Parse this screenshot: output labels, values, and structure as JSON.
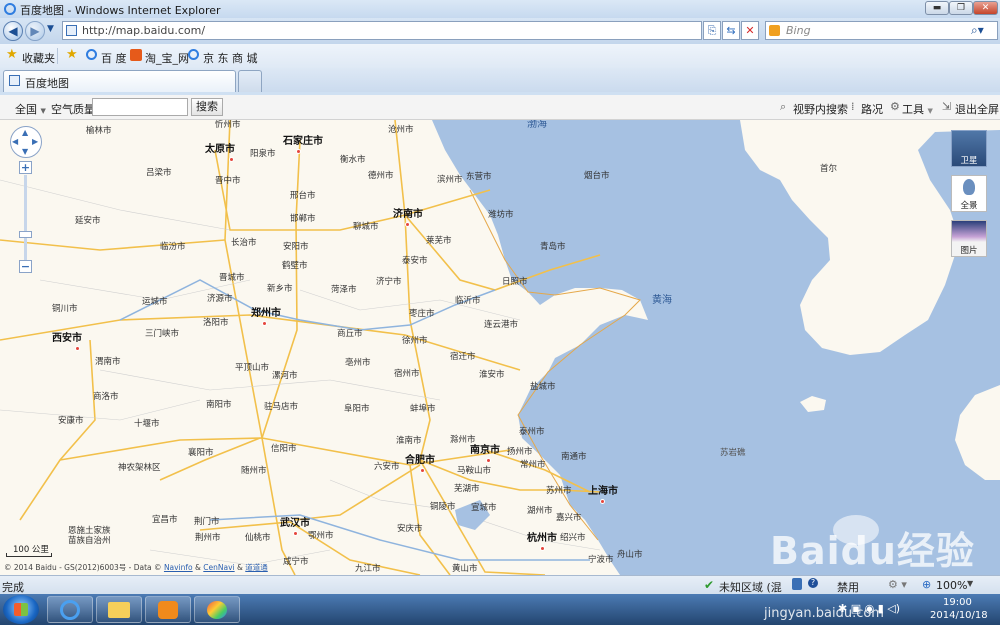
{
  "window": {
    "title": "百度地图 - Windows Internet Explorer"
  },
  "address": {
    "url": "http://map.baidu.com/",
    "search_placeholder": "Bing"
  },
  "favorites": {
    "label": "收藏夹",
    "items": [
      "百 度",
      "淘_宝_网",
      "京 东 商 城"
    ]
  },
  "tab": {
    "title": "百度地图"
  },
  "map_toolbar": {
    "region": "全国",
    "air_quality": "空气质量",
    "search_value": "",
    "search_button": "搜索",
    "right_items": [
      "视野内搜索",
      "路况",
      "工具",
      "退出全屏"
    ]
  },
  "map_side": {
    "satellite": "卫星",
    "panorama": "全景",
    "photo": "图片"
  },
  "map": {
    "scale": "100 公里",
    "copyright": [
      "© 2014 Baidu - GS(2012)6003号 - Data ©",
      "Navinfo",
      "&",
      "CenNavi",
      "&",
      "道道通"
    ],
    "seas": [
      "渤海",
      "黄海"
    ],
    "major_cities": [
      "太原市",
      "石家庄市",
      "济南市",
      "郑州市",
      "西安市",
      "合肥市",
      "南京市",
      "上海市",
      "武汉市",
      "杭州市",
      "首尔"
    ],
    "cities": [
      "榆林市",
      "忻州市",
      "沧州市",
      "吕梁市",
      "阳泉市",
      "衡水市",
      "德州市",
      "滨州市",
      "东营市",
      "烟台市",
      "晋中市",
      "邢台市",
      "潍坊市",
      "延安市",
      "邯郸市",
      "聊城市",
      "莱芜市",
      "临汾市",
      "长治市",
      "安阳市",
      "泰安市",
      "青岛市",
      "鹤壁市",
      "晋城市",
      "新乡市",
      "菏泽市",
      "济宁市",
      "日照市",
      "运城市",
      "济源市",
      "临沂市",
      "三门峡市",
      "洛阳市",
      "枣庄市",
      "连云港市",
      "铜川市",
      "商丘市",
      "徐州市",
      "宿迁市",
      "渭南市",
      "平顶山市",
      "漯河市",
      "亳州市",
      "宿州市",
      "淮安市",
      "商洛市",
      "南阳市",
      "驻马店市",
      "阜阳市",
      "蚌埠市",
      "盐城市",
      "安康市",
      "十堰市",
      "淮南市",
      "滁州市",
      "泰州市",
      "南通市",
      "襄阳市",
      "信阳市",
      "六安市",
      "扬州市",
      "马鞍山市",
      "常州市",
      "神农架林区",
      "随州市",
      "芜湖市",
      "苏州市",
      "铜陵市",
      "宣城市",
      "湖州市",
      "嘉兴市",
      "宜昌市",
      "荆门市",
      "恩施土家族苗族自治州",
      "荆州市",
      "仙桃市",
      "鄂州市",
      "安庆市",
      "宁波市",
      "绍兴市",
      "舟山市",
      "咸宁市",
      "九江市",
      "黄山市",
      "苏岩礁"
    ]
  },
  "status": {
    "done": "完成",
    "zone": "未知区域 (混",
    "zoom": "100%",
    "protected": "禁用"
  },
  "taskbar": {
    "time": "19:00",
    "date": "2014/10/18"
  },
  "watermark": {
    "text": "Baidu经验",
    "url": "jingyan.baidu.com"
  }
}
